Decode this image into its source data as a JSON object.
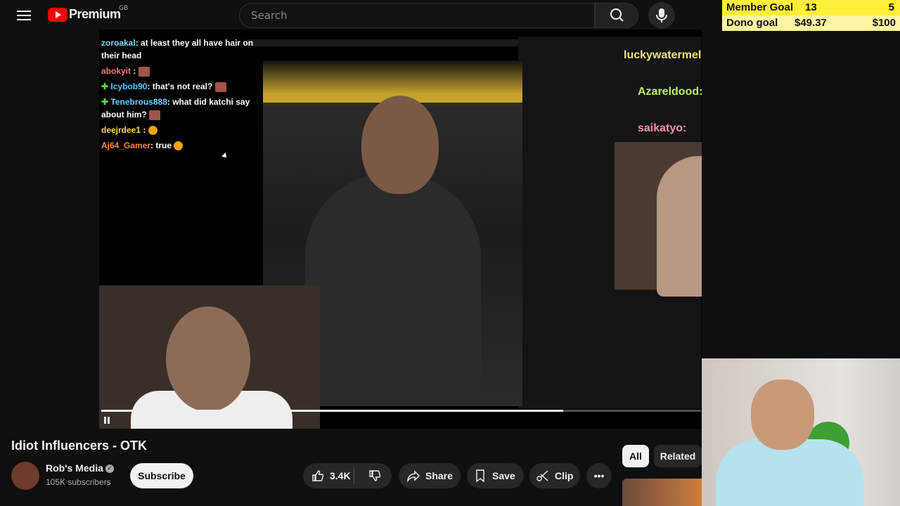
{
  "header": {
    "logo_text": "Premium",
    "country_code": "GB",
    "search_placeholder": "Search"
  },
  "goal_overlay": {
    "member_label": "Member Goal",
    "member_current": "13",
    "member_target": "5",
    "dono_label": "Dono goal",
    "dono_current": "$49.37",
    "dono_target": "$100"
  },
  "overlay_chat": [
    {
      "user": "zoroakal",
      "color": "#7ee0ff",
      "text": ": at least they all have hair on their head",
      "badge": false,
      "emote": false
    },
    {
      "user": "abokyit",
      "color": "#f08080",
      "text": " :",
      "badge": false,
      "emote": true
    },
    {
      "user": "Icybob90",
      "color": "#60c8ff",
      "text": ": that's not real?",
      "badge": true,
      "emote": true
    },
    {
      "user": "Tenebrous888",
      "color": "#6fd0ff",
      "text": ": what did katchi say about him?",
      "badge": true,
      "emote": true
    },
    {
      "user": "deejrdee1",
      "color": "#ffd84d",
      "text": " :",
      "badge": false,
      "emote": true
    },
    {
      "user": "Aj64_Gamer",
      "color": "#f58a46",
      "text": ": true",
      "badge": false,
      "emote": true
    }
  ],
  "right_chat": [
    {
      "text": "luckywatermelonjuice:",
      "style": "yellow"
    },
    {
      "text": "Azareldood:",
      "style": "green"
    },
    {
      "text": "saikatyo:",
      "style": "pink"
    }
  ],
  "player": {
    "progress_fraction": 0.77
  },
  "video": {
    "title": "Idiot Influencers - OTK",
    "channel": "Rob's Media",
    "subscribers": "105K subscribers",
    "subscribe_label": "Subscribe",
    "likes": "3.4K",
    "share_label": "Share",
    "save_label": "Save",
    "clip_label": "Clip",
    "more_label": "•••"
  },
  "chips": {
    "all": "All",
    "related": "Related"
  }
}
